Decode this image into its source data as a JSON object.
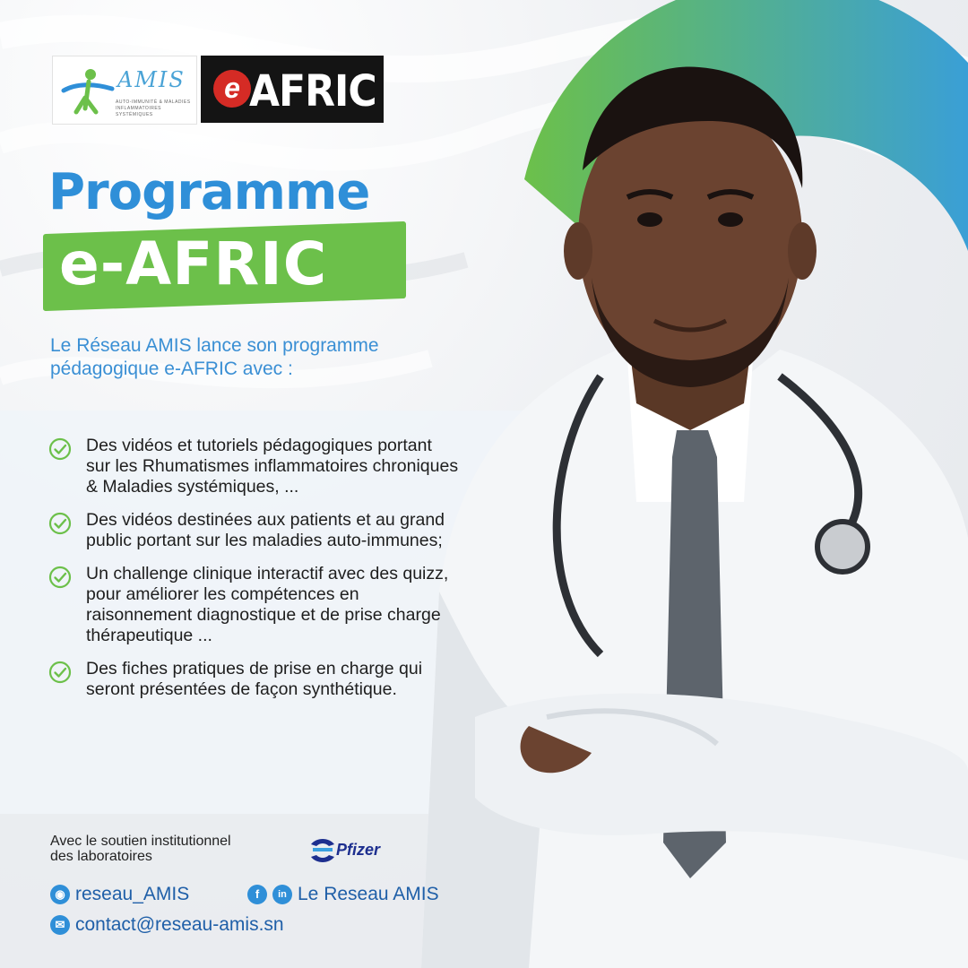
{
  "logos": {
    "amis": {
      "wordmark": "AMIS",
      "tagline": "AUTO-IMMUNITÉ & MALADIES INFLAMMATOIRES SYSTÉMIQUES"
    },
    "eafric": {
      "e_letter": "e",
      "wordmark": "AFRIC"
    }
  },
  "title": {
    "line1": "Programme",
    "line2": "e-AFRIC"
  },
  "intro": "Le Réseau AMIS lance son programme pédagogique e-AFRIC avec :",
  "features": [
    "Des vidéos et tutoriels pédagogiques portant sur les Rhumatismes inflammatoires chroniques & Maladies systémiques, ...",
    "Des vidéos destinées aux patients et au grand public portant sur les maladies auto-immunes;",
    "Un challenge clinique interactif avec des quizz, pour améliorer les compétences en raisonnement diagnostique et de prise charge thérapeutique ...",
    "Des fiches pratiques de prise en charge qui seront présentées de façon synthétique."
  ],
  "support": {
    "line1": "Avec le soutien institutionnel",
    "line2": "des laboratoires",
    "sponsor": "Pfizer"
  },
  "contacts": {
    "instagram": "reseau_AMIS",
    "facebook_linkedin": "Le Reseau AMIS",
    "email": "contact@reseau-amis.sn"
  },
  "colors": {
    "blue": "#2f8fd8",
    "green": "#6cc04a",
    "eafric_red": "#d52b25",
    "pfizer_blue": "#1d2f8f"
  },
  "icons": [
    "check-circle-icon",
    "instagram-icon",
    "facebook-icon",
    "linkedin-icon",
    "email-icon"
  ]
}
